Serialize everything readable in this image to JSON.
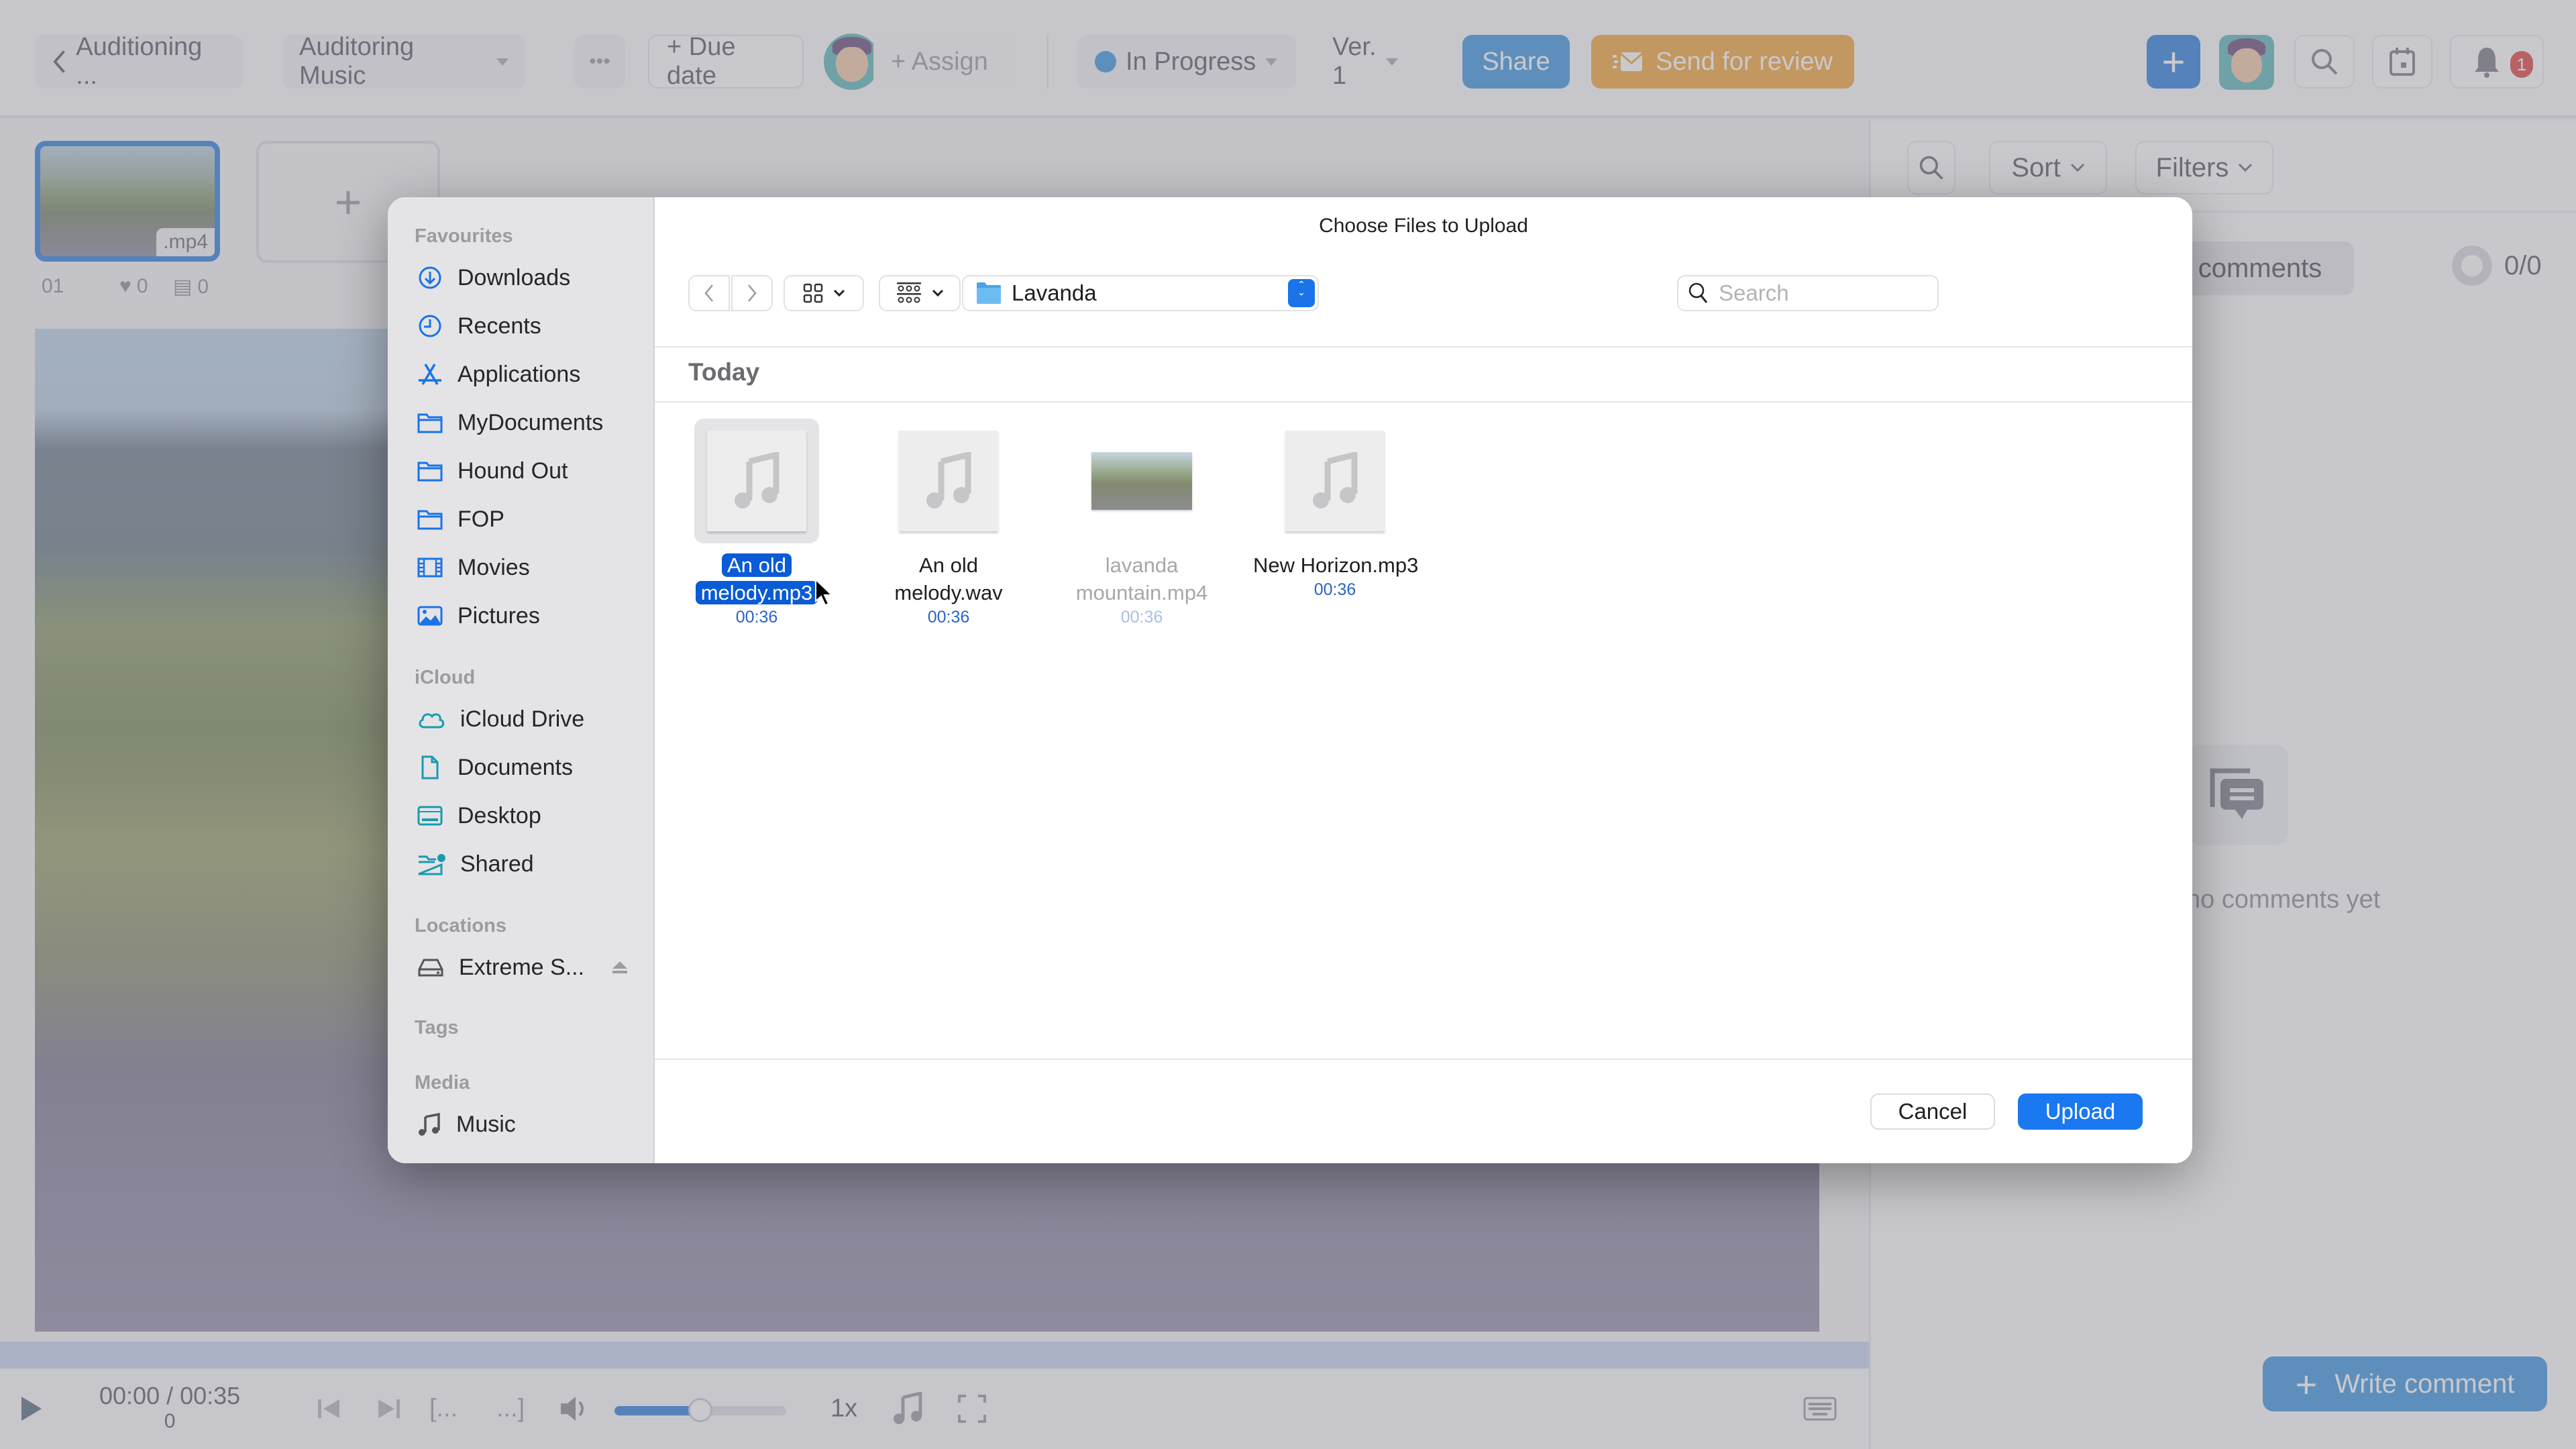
{
  "topbar": {
    "back_label": "Auditioning ...",
    "project_label": "Auditoring Music",
    "more_label": "•••",
    "due_date_label": "+ Due date",
    "assign_label": "+ Assign",
    "status_label": "In Progress",
    "status_color": "#3d95e0",
    "version_label": "Ver. 1",
    "share_label": "Share",
    "send_review_label": "Send for review",
    "notification_count": "1"
  },
  "assets": {
    "items": [
      {
        "index": "01",
        "ext": ".mp4",
        "likes": "0",
        "comments": "0"
      }
    ],
    "add_label": "+"
  },
  "player": {
    "current_time": "00:00",
    "separator": " / ",
    "total_time": "00:35",
    "frame": "0",
    "speed": "1x",
    "volume_percent": 50
  },
  "comments_panel": {
    "sort_label": "Sort",
    "filters_label": "Filters",
    "tab_label": "comments",
    "count": "0/0",
    "empty_text": "no comments yet",
    "write_label": "Write comment"
  },
  "dialog": {
    "title": "Choose Files to Upload",
    "location": "Lavanda",
    "search_placeholder": "Search",
    "group_label": "Today",
    "cancel_label": "Cancel",
    "upload_label": "Upload",
    "sidebar": {
      "favourites_label": "Favourites",
      "favourites": [
        {
          "label": "Downloads",
          "icon": "download-icon"
        },
        {
          "label": "Recents",
          "icon": "clock-icon"
        },
        {
          "label": "Applications",
          "icon": "applications-icon"
        },
        {
          "label": "MyDocuments",
          "icon": "folder-icon"
        },
        {
          "label": "Hound Out",
          "icon": "folder-icon"
        },
        {
          "label": "FOP",
          "icon": "folder-icon"
        },
        {
          "label": "Movies",
          "icon": "film-icon"
        },
        {
          "label": "Pictures",
          "icon": "photo-icon"
        }
      ],
      "icloud_label": "iCloud",
      "icloud": [
        {
          "label": "iCloud Drive",
          "icon": "cloud-icon"
        },
        {
          "label": "Documents",
          "icon": "document-icon"
        },
        {
          "label": "Desktop",
          "icon": "desktop-icon"
        },
        {
          "label": "Shared",
          "icon": "shared-folder-icon"
        }
      ],
      "locations_label": "Locations",
      "locations": [
        {
          "label": "Extreme S...",
          "icon": "drive-icon"
        }
      ],
      "tags_label": "Tags",
      "media_label": "Media",
      "media": [
        {
          "label": "Music",
          "icon": "music-note-icon"
        }
      ]
    },
    "files": [
      {
        "line1": "An old",
        "line2": "melody.mp3",
        "duration": "00:36",
        "type": "audio",
        "state": "selected"
      },
      {
        "line1": "An old",
        "line2": "melody.wav",
        "duration": "00:36",
        "type": "audio",
        "state": "normal"
      },
      {
        "line1": "lavanda",
        "line2": "mountain.mp4",
        "duration": "00:36",
        "type": "video",
        "state": "disabled"
      },
      {
        "line1": "New Horizon.mp3",
        "line2": "",
        "duration": "00:36",
        "type": "audio",
        "state": "normal"
      }
    ]
  }
}
